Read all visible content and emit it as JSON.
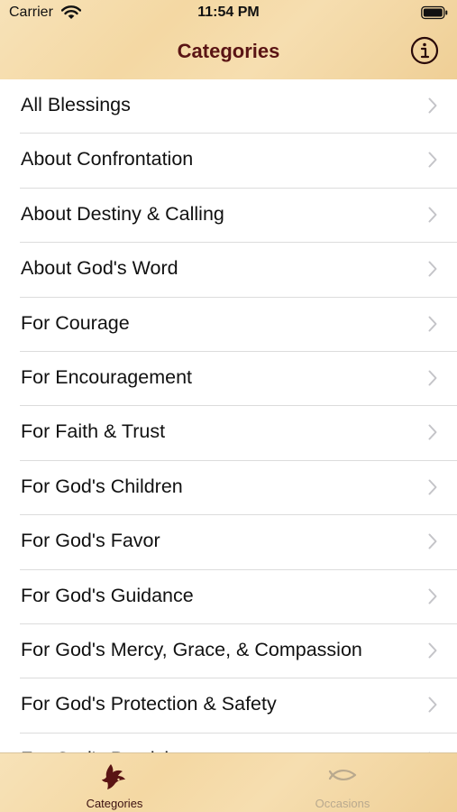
{
  "status_bar": {
    "carrier": "Carrier",
    "time": "11:54 PM"
  },
  "nav": {
    "title": "Categories",
    "info_icon": "info-circle-icon"
  },
  "categories": [
    {
      "label": "All Blessings"
    },
    {
      "label": "About Confrontation"
    },
    {
      "label": "About Destiny & Calling"
    },
    {
      "label": "About God's Word"
    },
    {
      "label": "For Courage"
    },
    {
      "label": "For Encouragement"
    },
    {
      "label": "For Faith & Trust"
    },
    {
      "label": "For God's Children"
    },
    {
      "label": "For God's Favor"
    },
    {
      "label": "For God's Guidance"
    },
    {
      "label": "For God's Mercy, Grace, & Compassion"
    },
    {
      "label": "For God's Protection & Safety"
    },
    {
      "label": "For God's Provision"
    }
  ],
  "tabbar": {
    "tabs": [
      {
        "label": "Categories",
        "icon": "dove-icon",
        "active": true
      },
      {
        "label": "Occasions",
        "icon": "fish-icon",
        "active": false
      }
    ]
  },
  "colors": {
    "accent": "#5a1414",
    "inactive_tab": "#b9a98e",
    "parchment": "#f4d8a3"
  }
}
